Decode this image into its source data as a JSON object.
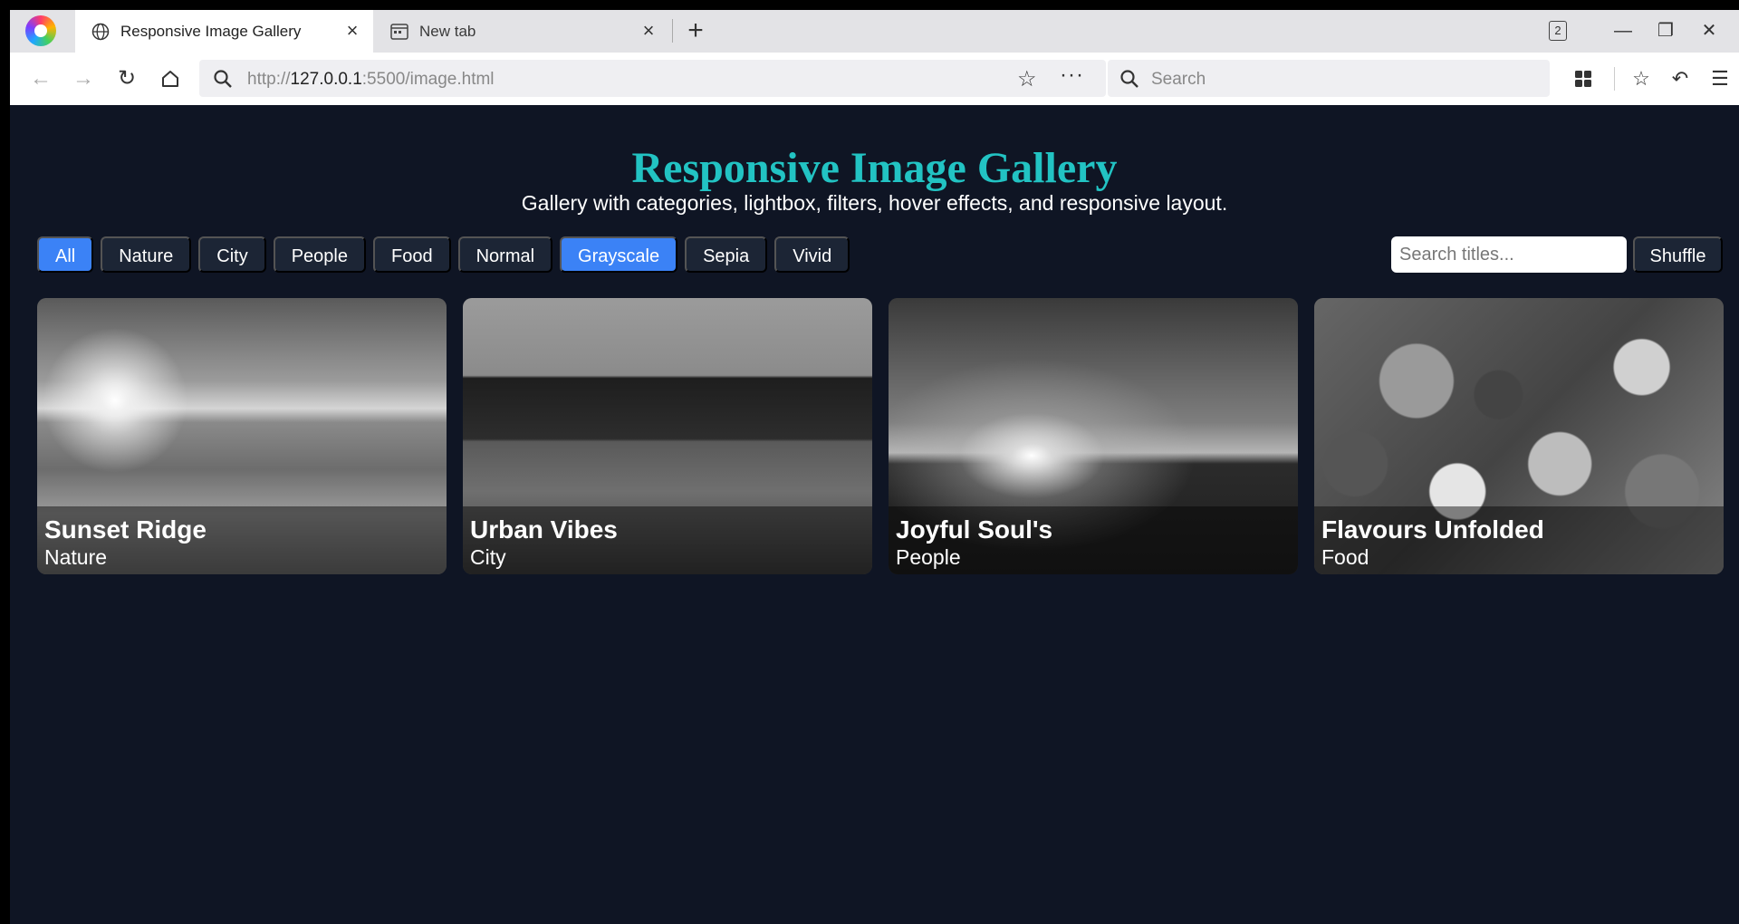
{
  "browser": {
    "tabs": [
      {
        "label": "Responsive Image Gallery",
        "icon": "globe-icon",
        "active": true
      },
      {
        "label": "New tab",
        "icon": "newtab-icon",
        "active": false
      }
    ],
    "tab_count": "2",
    "url_prefix": "http://",
    "url_host": "127.0.0.1",
    "url_rest": ":5500/image.html",
    "search_placeholder": "Search"
  },
  "page": {
    "title": "Responsive Image Gallery",
    "subtitle": "Gallery with categories, lightbox, filters, hover effects, and responsive layout.",
    "category_filters": [
      "All",
      "Nature",
      "City",
      "People",
      "Food"
    ],
    "image_filters": [
      "Normal",
      "Grayscale",
      "Sepia",
      "Vivid"
    ],
    "active_category": "All",
    "active_image_filter": "Grayscale",
    "search_placeholder": "Search titles...",
    "shuffle_label": "Shuffle",
    "accent_color": "#3b82f6",
    "title_color": "#22c3c3",
    "cards": [
      {
        "title": "Sunset Ridge",
        "category": "Nature"
      },
      {
        "title": "Urban Vibes",
        "category": "City"
      },
      {
        "title": "Joyful Soul's",
        "category": "People"
      },
      {
        "title": "Flavours Unfolded",
        "category": "Food"
      }
    ]
  }
}
